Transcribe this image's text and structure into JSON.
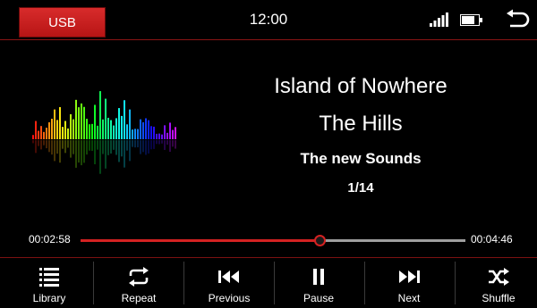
{
  "top_bar": {
    "source_label": "USB",
    "clock": "12:00",
    "icons": [
      "signal-icon",
      "battery-icon",
      "back-icon"
    ]
  },
  "now_playing": {
    "title": "Island of Nowhere",
    "artist": "The Hills",
    "album": "The new Sounds",
    "track_position": "1/14"
  },
  "progress": {
    "elapsed": "00:02:58",
    "total": "00:04:46",
    "fraction": 0.622
  },
  "controls": [
    {
      "label": "Library",
      "icon": "library-list-icon"
    },
    {
      "label": "Repeat",
      "icon": "repeat-icon"
    },
    {
      "label": "Previous",
      "icon": "previous-icon"
    },
    {
      "label": "Pause",
      "icon": "pause-icon"
    },
    {
      "label": "Next",
      "icon": "next-icon"
    },
    {
      "label": "Shuffle",
      "icon": "shuffle-icon"
    }
  ],
  "colors": {
    "accent": "#d42222",
    "background": "#000000",
    "track": "#9e9e9e"
  }
}
